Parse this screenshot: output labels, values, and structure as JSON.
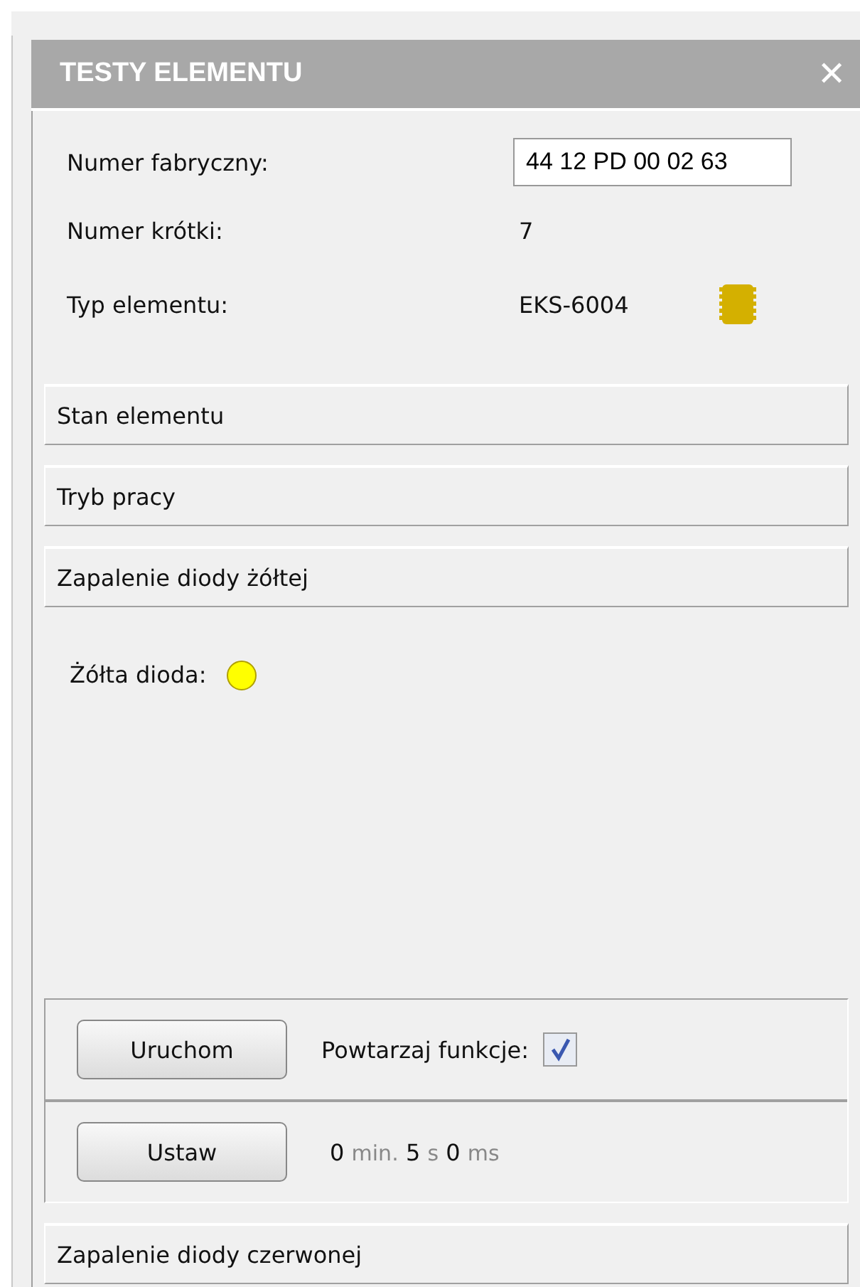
{
  "panel": {
    "title": "TESTY ELEMENTU",
    "close": "✕"
  },
  "fields": [
    {
      "kind": "input",
      "label": "Numer fabryczny:",
      "value": "44 12 PD 00 02 63"
    },
    {
      "kind": "text",
      "label": "Numer krótki:",
      "value": "7"
    },
    {
      "kind": "chip",
      "label": "Typ elementu:",
      "value": "EKS-6004"
    }
  ],
  "sections": [
    {
      "title": "Stan elementu",
      "expanded": false
    },
    {
      "title": "Tryb pracy",
      "expanded": false
    },
    {
      "title": "Zapalenie diody żółtej",
      "expanded": true,
      "indicator": {
        "label": "Żółta dioda:",
        "color": "#ffff00"
      },
      "run_button": "Uruchom",
      "repeat": {
        "label": "Powtarzaj funkcje:",
        "checked": true
      },
      "set_button": "Ustaw",
      "timer": [
        {
          "value": "0",
          "unit": "min."
        },
        {
          "value": "5",
          "unit": "s"
        },
        {
          "value": "0",
          "unit": "ms"
        }
      ]
    },
    {
      "title": "Zapalenie diody czerwonej",
      "expanded": false
    }
  ]
}
